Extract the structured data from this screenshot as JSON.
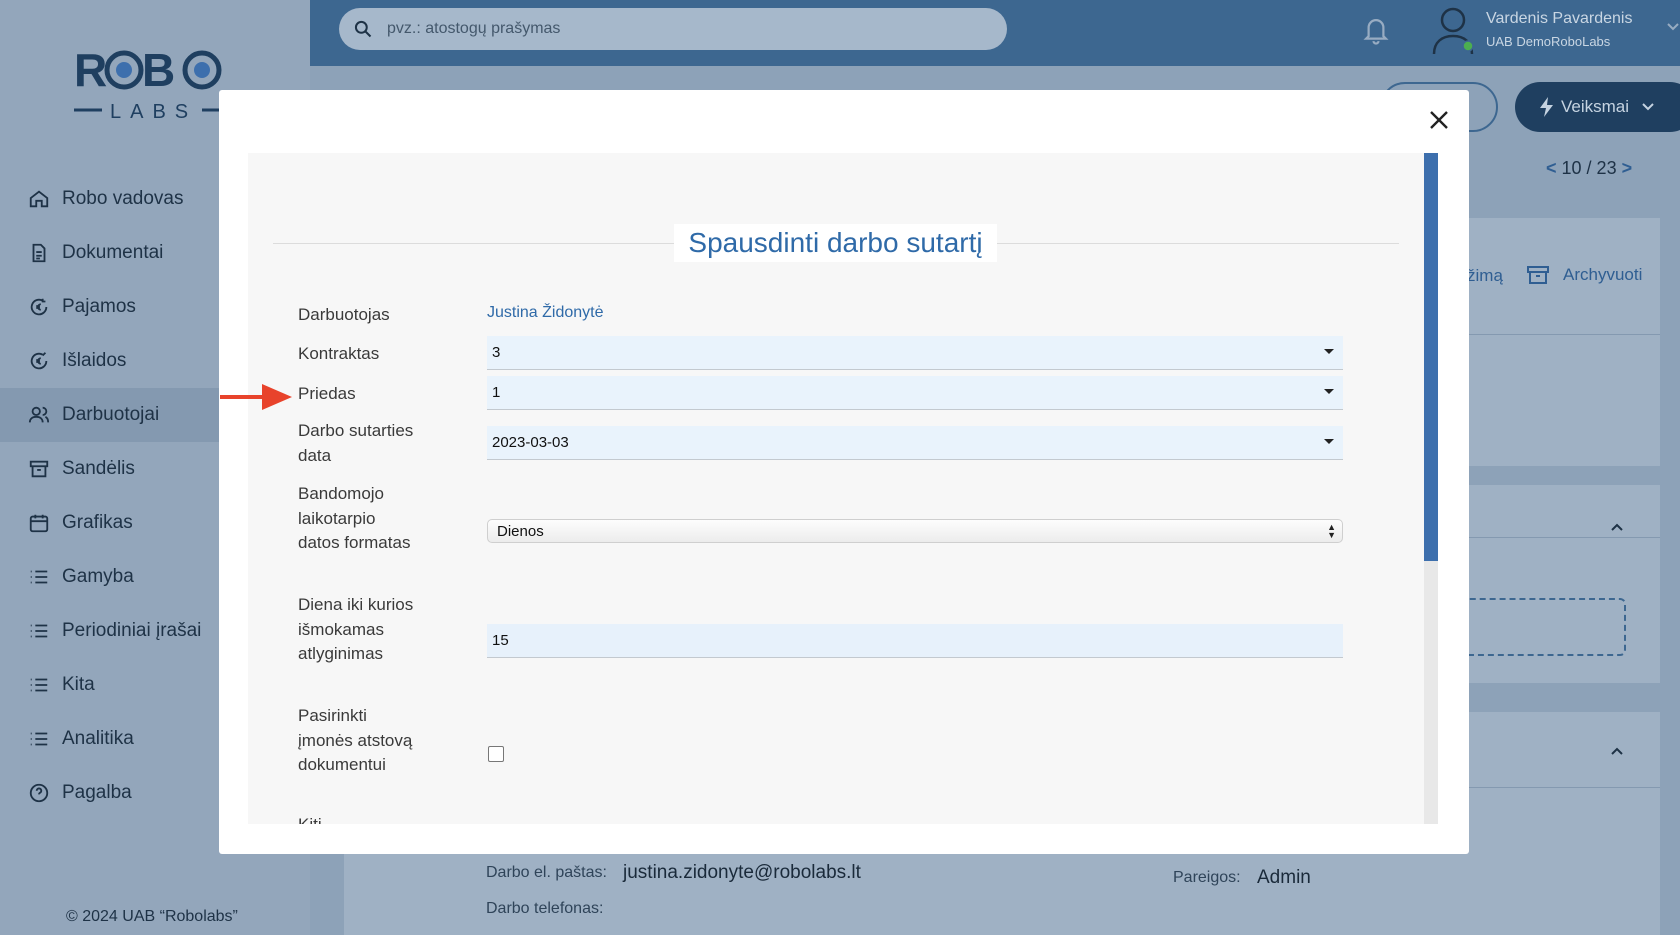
{
  "brand": {
    "logo_top": "ROBO",
    "logo_bottom": "LABS"
  },
  "sidebar": {
    "items": [
      {
        "label": "Robo vadovas",
        "icon": "home-icon"
      },
      {
        "label": "Dokumentai",
        "icon": "document-icon"
      },
      {
        "label": "Pajamos",
        "icon": "income-icon"
      },
      {
        "label": "Išlaidos",
        "icon": "expenses-icon"
      },
      {
        "label": "Darbuotojai",
        "icon": "users-icon",
        "active": true
      },
      {
        "label": "Sandėlis",
        "icon": "archive-box-icon"
      },
      {
        "label": "Grafikas",
        "icon": "calendar-icon"
      },
      {
        "label": "Gamyba",
        "icon": "list-icon"
      },
      {
        "label": "Periodiniai įrašai",
        "icon": "list-icon"
      },
      {
        "label": "Kita",
        "icon": "list-icon"
      },
      {
        "label": "Analitika",
        "icon": "list-icon"
      },
      {
        "label": "Pagalba",
        "icon": "help-icon"
      }
    ],
    "copyright": "© 2024 UAB “Robolabs”"
  },
  "header": {
    "search_placeholder": "pvz.: atostogų prašymas",
    "user_name": "Vardenis Pavardenis",
    "user_company": "UAB DemoRoboLabs"
  },
  "toolbar": {
    "actions_label": "Veiksmai",
    "pager": "10 / 23",
    "archive_label": "Archyvuoti",
    "partial_label": "žimą"
  },
  "background_details": {
    "work_email_label": "Darbo el. paštas:",
    "work_email_value": "justina.zidonyte@robolabs.lt",
    "work_phone_label": "Darbo telefonas:",
    "position_label": "Pareigos:",
    "position_value": "Admin"
  },
  "modal": {
    "title": "Spausdinti darbo sutartį",
    "fields": {
      "employee_label": "Darbuotojas",
      "employee_value": "Justina Židonytė",
      "contract_label": "Kontraktas",
      "contract_value": "3",
      "appendix_label": "Priedas",
      "appendix_value": "1",
      "contract_date_label": "Darbo sutarties data",
      "contract_date_value": "2023-03-03",
      "trial_format_label": "Bandomojo laikotarpio datos formatas",
      "trial_format_value": "Dienos",
      "pay_day_label": "Diena iki kurios išmokamas atlyginimas",
      "pay_day_value": "15",
      "rep_label": "Pasirinkti įmonės atstovą dokumentui",
      "rep_checked": false,
      "next_label": "Kiti"
    }
  },
  "colors": {
    "accent": "#2f6aa8",
    "topbar": "#3d6790",
    "annotation_arrow": "#e8432b"
  }
}
